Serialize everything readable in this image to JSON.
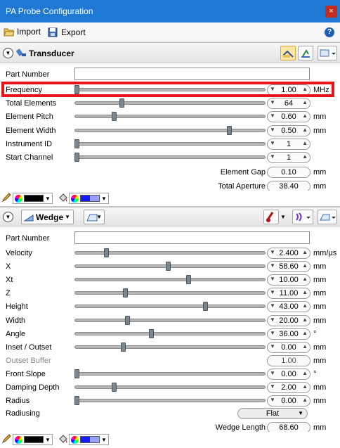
{
  "window": {
    "title": "PA Probe Configuration",
    "close": "×"
  },
  "toolbar": {
    "import_label": "Import",
    "export_label": "Export",
    "help": "?"
  },
  "transducer": {
    "title": "Transducer",
    "part_number_label": "Part Number",
    "part_number_value": "",
    "rows": [
      {
        "label": "Frequency",
        "value": "1.00",
        "unit": "MHz",
        "level": 0.0
      },
      {
        "label": "Total Elements",
        "value": "64",
        "unit": "",
        "level": 0.24
      },
      {
        "label": "Element Pitch",
        "value": "0.60",
        "unit": "mm",
        "level": 0.2
      },
      {
        "label": "Element Width",
        "value": "0.50",
        "unit": "mm",
        "level": 0.82
      },
      {
        "label": "Instrument ID",
        "value": "1",
        "unit": "",
        "level": 0.0
      },
      {
        "label": "Start Channel",
        "value": "1",
        "unit": "",
        "level": 0.0
      }
    ],
    "element_gap_label": "Element Gap",
    "element_gap_value": "0.10",
    "element_gap_unit": "mm",
    "total_aperture_label": "Total Aperture",
    "total_aperture_value": "38.40",
    "total_aperture_unit": "mm"
  },
  "wedge": {
    "title": "Wedge",
    "part_number_label": "Part Number",
    "part_number_value": "",
    "rows": [
      {
        "label": "Velocity",
        "value": "2.400",
        "unit": "mm/µs",
        "level": 0.16,
        "dim": false
      },
      {
        "label": "X",
        "value": "58.60",
        "unit": "mm",
        "level": 0.49,
        "dim": false
      },
      {
        "label": "Xt",
        "value": "10.00",
        "unit": "mm",
        "level": 0.6,
        "dim": false
      },
      {
        "label": "Z",
        "value": "11.00",
        "unit": "mm",
        "level": 0.26,
        "dim": false
      },
      {
        "label": "Height",
        "value": "43.00",
        "unit": "mm",
        "level": 0.69,
        "dim": false
      },
      {
        "label": "Width",
        "value": "20.00",
        "unit": "mm",
        "level": 0.27,
        "dim": false
      },
      {
        "label": "Angle",
        "value": "36.00",
        "unit": "°",
        "level": 0.4,
        "dim": false
      },
      {
        "label": "Inset / Outset",
        "value": "0.00",
        "unit": "mm",
        "level": 0.25,
        "dim": false
      },
      {
        "label": "Outset Buffer",
        "value": "1.00",
        "unit": "mm",
        "level": null,
        "dim": true
      },
      {
        "label": "Front Slope",
        "value": "0.00",
        "unit": "°",
        "level": 0.0,
        "dim": false
      },
      {
        "label": "Damping Depth",
        "value": "2.00",
        "unit": "mm",
        "level": 0.2,
        "dim": false
      },
      {
        "label": "Radius",
        "value": "0.00",
        "unit": "mm",
        "level": 0.0,
        "dim": false
      }
    ],
    "radiusing_label": "Radiusing",
    "radiusing_value": "Flat",
    "wedge_length_label": "Wedge Length",
    "wedge_length_value": "68.60",
    "wedge_length_unit": "mm"
  },
  "colors": {
    "line_color": "#000000",
    "fill_color": "#1a1aff",
    "accent": "#1f78d1",
    "highlight": "#e8141a"
  }
}
